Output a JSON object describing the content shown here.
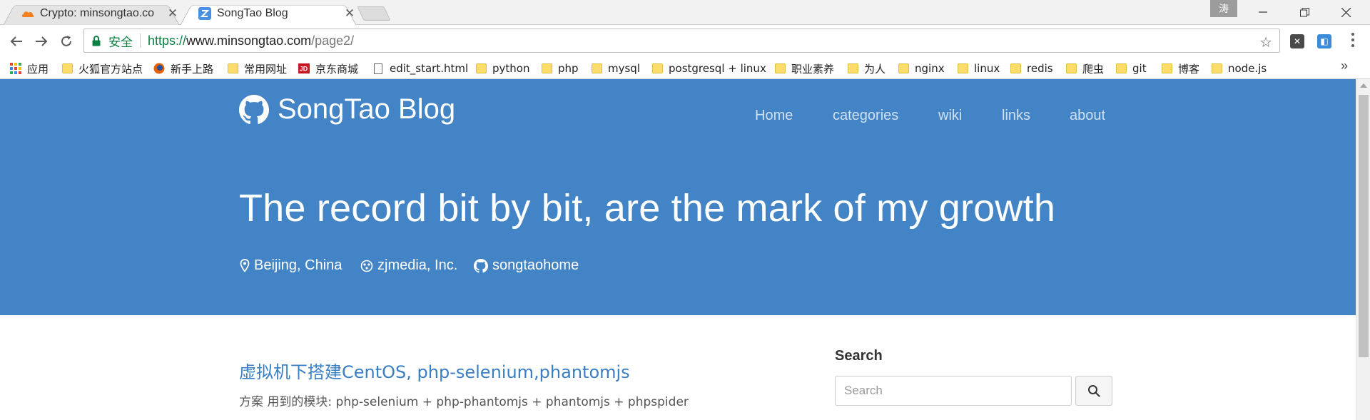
{
  "browser": {
    "tabs": [
      {
        "title": "Crypto: minsongtao.co",
        "favicon": "cloudflare-icon",
        "active": false
      },
      {
        "title": "SongTao Blog",
        "favicon": "site-logo-icon",
        "active": true
      }
    ],
    "profile_badge": "涛",
    "address_bar": {
      "security_label": "安全",
      "url_scheme": "https://",
      "url_host": "www.minsongtao.com",
      "url_path": "/page2/"
    },
    "bookmarks": [
      {
        "label": "应用",
        "icon": "apps-grid-icon"
      },
      {
        "label": "火狐官方站点",
        "icon": "folder-icon"
      },
      {
        "label": "新手上路",
        "icon": "firefox-icon"
      },
      {
        "label": "常用网址",
        "icon": "folder-icon"
      },
      {
        "label": "京东商城",
        "icon": "jd-icon"
      },
      {
        "label": "edit_start.html",
        "icon": "page-icon"
      },
      {
        "label": "python",
        "icon": "folder-icon"
      },
      {
        "label": "php",
        "icon": "folder-icon"
      },
      {
        "label": "mysql",
        "icon": "folder-icon"
      },
      {
        "label": "postgresql + linux",
        "icon": "folder-icon"
      },
      {
        "label": "职业素养",
        "icon": "folder-icon"
      },
      {
        "label": "为人",
        "icon": "folder-icon"
      },
      {
        "label": "nginx",
        "icon": "folder-icon"
      },
      {
        "label": "linux",
        "icon": "folder-icon"
      },
      {
        "label": "redis",
        "icon": "folder-icon"
      },
      {
        "label": "爬虫",
        "icon": "folder-icon"
      },
      {
        "label": "git",
        "icon": "folder-icon"
      },
      {
        "label": "博客",
        "icon": "folder-icon"
      },
      {
        "label": "node.js",
        "icon": "folder-icon"
      }
    ],
    "bookmarks_overflow": "»"
  },
  "site": {
    "brand": "SongTao Blog",
    "nav": [
      "Home",
      "categories",
      "wiki",
      "links",
      "about"
    ],
    "headline": "The record bit by bit, are the mark of my growth",
    "meta": {
      "location": "Beijing, China",
      "company": "zjmedia, Inc.",
      "github": "songtaohome"
    },
    "post": {
      "title": "虚拟机下搭建CentOS, php-selenium,phantomjs",
      "summary": "方案 用到的模块: php-selenium + php-phantomjs + phantomjs + phpspider"
    },
    "sidebar": {
      "search_heading": "Search",
      "search_placeholder": "Search"
    }
  },
  "colors": {
    "hero_bg": "#4384c6",
    "link": "#3a7fc4",
    "secure_green": "#0b8043"
  }
}
